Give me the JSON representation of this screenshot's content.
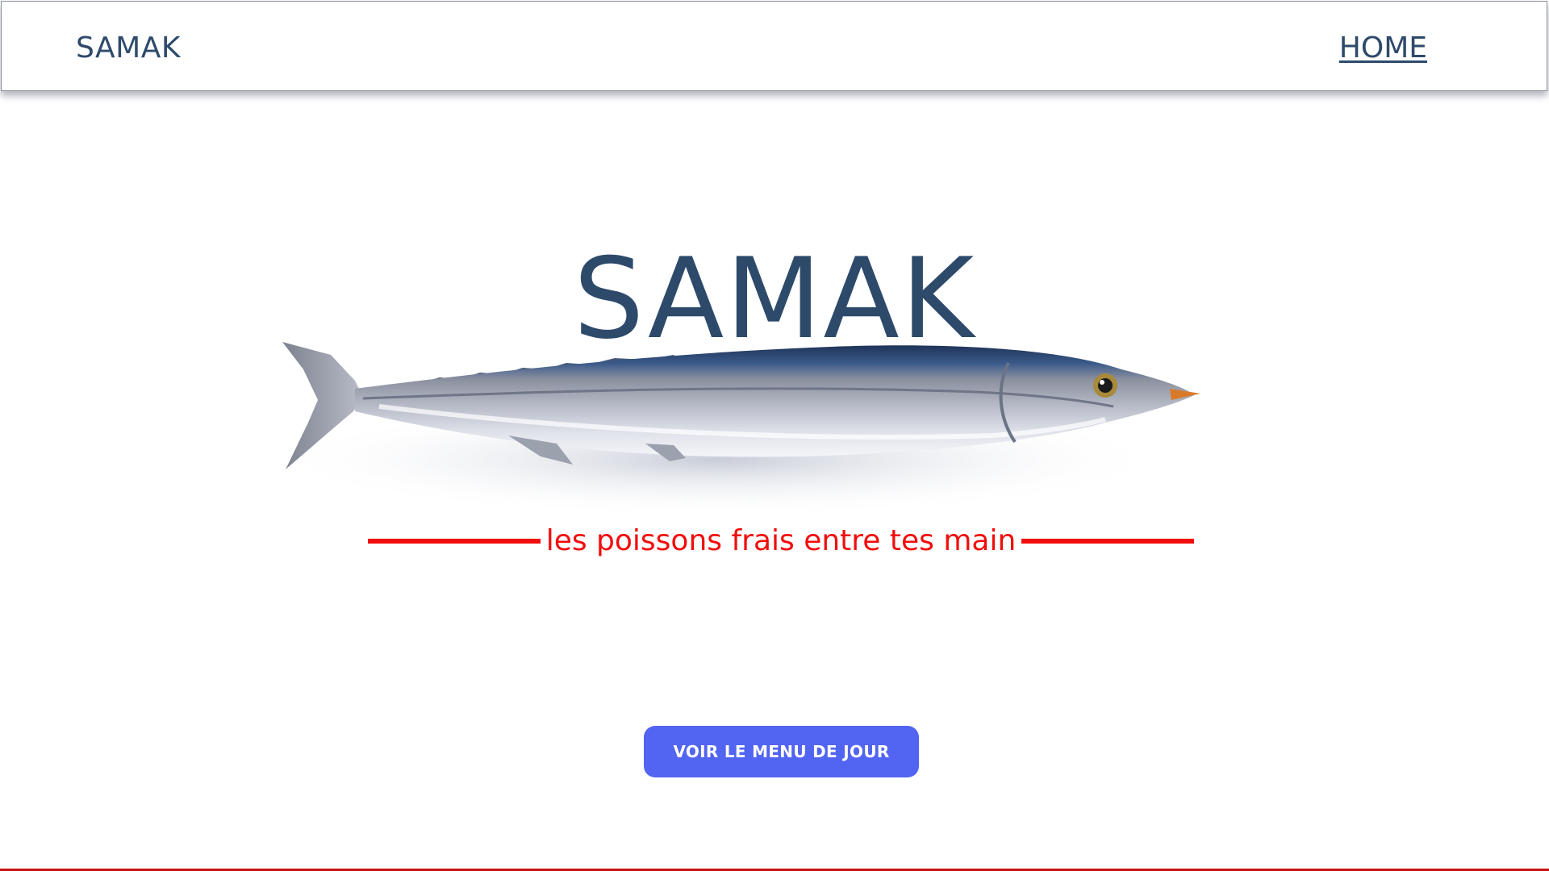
{
  "navbar": {
    "brand": "SAMAK",
    "home_link": "HOME"
  },
  "hero": {
    "title": "SAMAK",
    "tagline": "les poissons frais entre tes main",
    "image": "fish-photo"
  },
  "cta": {
    "label": "VOIR LE MENU DE JOUR"
  },
  "colors": {
    "brand_text": "#2e4a6b",
    "tagline_red": "#f20d0d",
    "button_blue": "#5264f2",
    "footer_line": "#cc1111"
  }
}
